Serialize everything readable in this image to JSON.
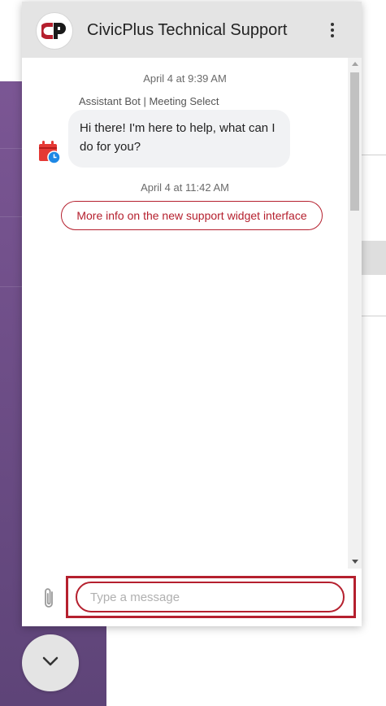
{
  "header": {
    "title": "CivicPlus Technical Support",
    "brand_color": "#b5202e",
    "logo_icon": "civicplus-logo-icon",
    "menu_icon": "vertical-dots-icon"
  },
  "messages": {
    "timestamp_1": "April 4 at 9:39 AM",
    "bot_name": "Assistant Bot | Meeting Select",
    "bot_avatar_icon": "calendar-clock-icon",
    "bot_message": "Hi there! I'm here to help, what can I do for you?",
    "timestamp_2": "April 4 at 11:42 AM",
    "quick_reply": "More info on the new support widget interface"
  },
  "composer": {
    "attach_icon": "paperclip-icon",
    "placeholder": "Type a message",
    "value": ""
  },
  "launcher": {
    "icon": "chevron-down-icon"
  }
}
